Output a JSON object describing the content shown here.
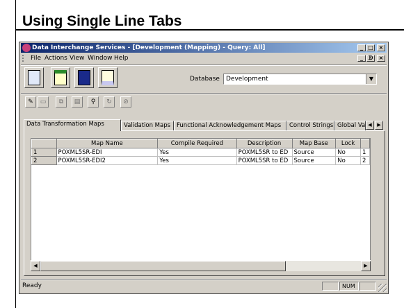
{
  "slide": {
    "title": "Using Single Line Tabs"
  },
  "window": {
    "title": "Data Interchange Services - [Development (Mapping)  - Query: All]",
    "min": "_",
    "max": "□",
    "close": "×",
    "restore": "ᗫ"
  },
  "menu": {
    "file": "File",
    "actions": "Actions",
    "view": "View",
    "window": "Window",
    "help": "Help"
  },
  "toolbar": {
    "database_label": "Database",
    "database_value": "Development"
  },
  "tabs": [
    {
      "label": "Data Transformation Maps"
    },
    {
      "label": "Validation Maps"
    },
    {
      "label": "Functional Acknowledgement Maps"
    },
    {
      "label": "Control Strings"
    },
    {
      "label": "Global Va"
    }
  ],
  "grid": {
    "columns": [
      "",
      "Map Name",
      "Compile Required",
      "Description",
      "Map Base",
      "Lock",
      ""
    ],
    "rows": [
      {
        "num": "1",
        "map_name": "POXML5SR-EDI",
        "compile": "Yes",
        "description": "POXML5SR to ED",
        "base": "Source",
        "lock": "No",
        "extra": "1"
      },
      {
        "num": "2",
        "map_name": "POXML5SR-EDI2",
        "compile": "Yes",
        "description": "POXML5SR to ED",
        "base": "Source",
        "lock": "No",
        "extra": "2"
      }
    ]
  },
  "status": {
    "text": "Ready",
    "num": "NUM"
  },
  "colors": {
    "title_start": "#0a246a",
    "title_end": "#a6caf0",
    "face": "#d4d0c8"
  }
}
